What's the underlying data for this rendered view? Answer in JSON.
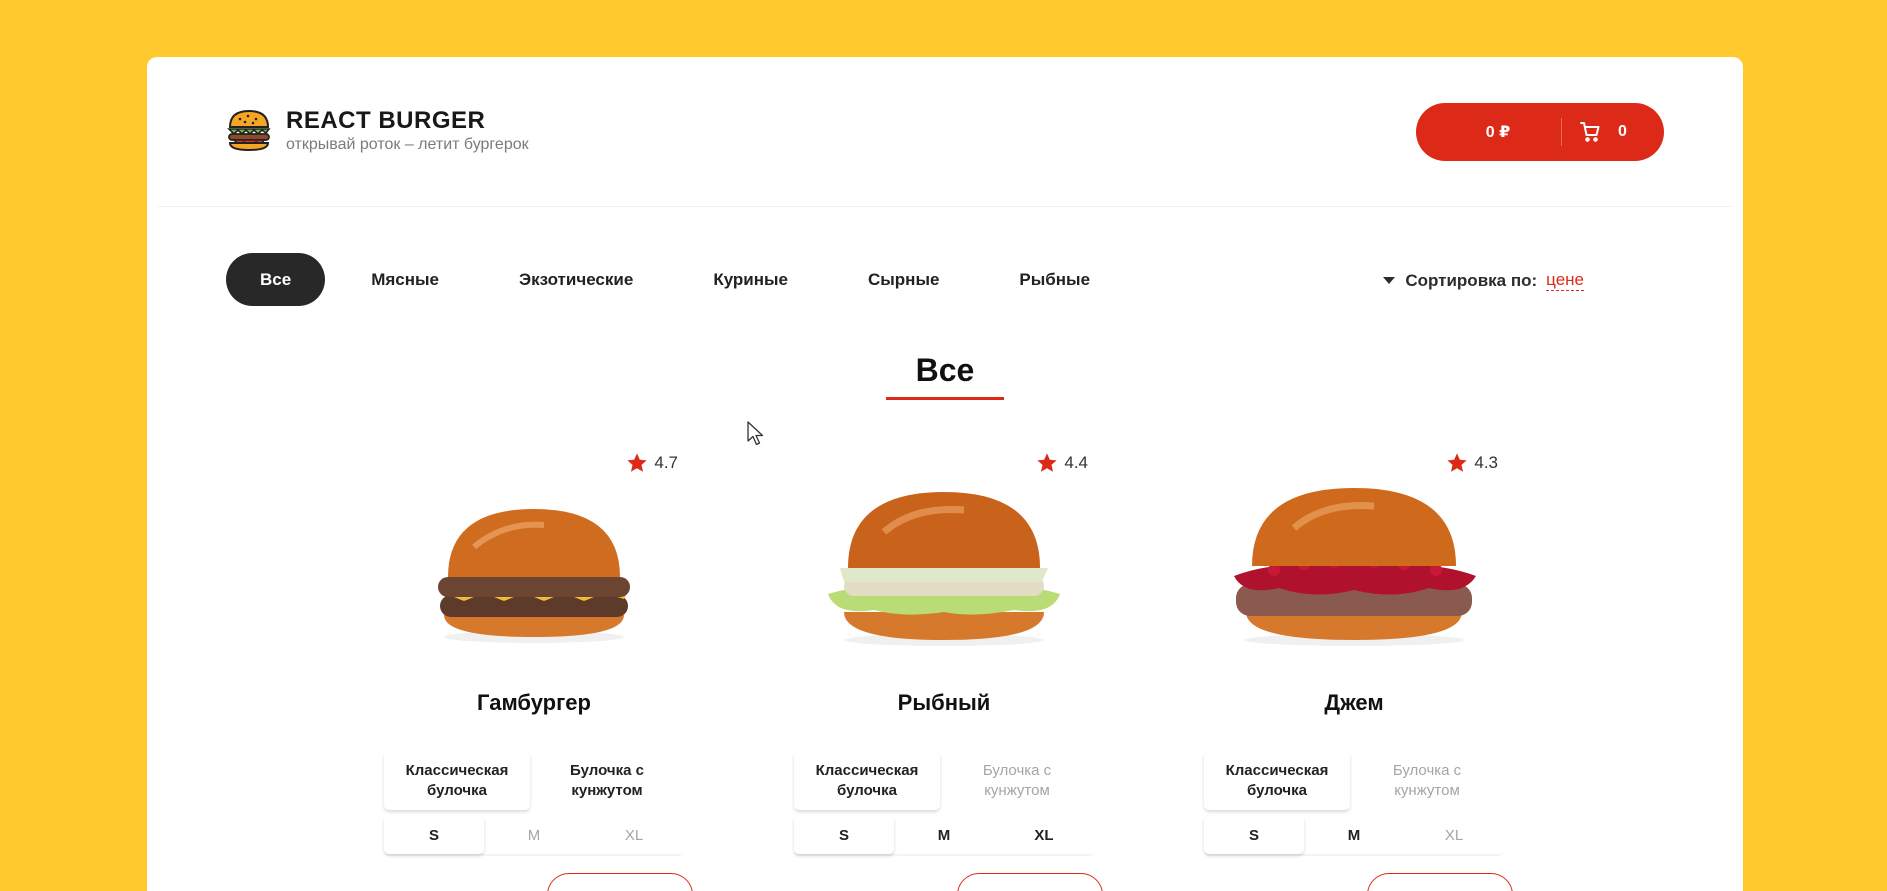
{
  "header": {
    "title": "REACT BURGER",
    "subtitle": "открывай роток – летит бургерок",
    "cart_price": "0 ₽",
    "cart_count": "0"
  },
  "categories": [
    {
      "label": "Все",
      "active": true
    },
    {
      "label": "Мясные",
      "active": false
    },
    {
      "label": "Экзотические",
      "active": false
    },
    {
      "label": "Куриные",
      "active": false
    },
    {
      "label": "Сырные",
      "active": false
    },
    {
      "label": "Рыбные",
      "active": false
    }
  ],
  "sort": {
    "label": "Сортировка по:",
    "value": "цене"
  },
  "section_title": "Все",
  "products": [
    {
      "title": "Гамбургер",
      "rating": "4.7",
      "buns": [
        {
          "label": "Классическая булочка",
          "state": "active"
        },
        {
          "label": "Булочка с кунжутом",
          "state": "normal"
        }
      ],
      "sizes": [
        {
          "label": "S",
          "state": "active"
        },
        {
          "label": "M",
          "state": "disabled"
        },
        {
          "label": "XL",
          "state": "disabled"
        }
      ],
      "price": "",
      "add_label": ""
    },
    {
      "title": "Рыбный",
      "rating": "4.4",
      "buns": [
        {
          "label": "Классическая булочка",
          "state": "active"
        },
        {
          "label": "Булочка с кунжутом",
          "state": "disabled"
        }
      ],
      "sizes": [
        {
          "label": "S",
          "state": "active"
        },
        {
          "label": "M",
          "state": "normal"
        },
        {
          "label": "XL",
          "state": "normal"
        }
      ],
      "price": "",
      "add_label": ""
    },
    {
      "title": "Джем",
      "rating": "4.3",
      "buns": [
        {
          "label": "Классическая булочка",
          "state": "active"
        },
        {
          "label": "Булочка с кунжутом",
          "state": "disabled"
        }
      ],
      "sizes": [
        {
          "label": "S",
          "state": "active"
        },
        {
          "label": "M",
          "state": "normal"
        },
        {
          "label": "XL",
          "state": "disabled"
        }
      ],
      "price": "",
      "add_label": ""
    }
  ],
  "colors": {
    "background": "#ffc82c",
    "accent": "#dd2a18",
    "dark": "#282828"
  },
  "icons": [
    "burger-logo-icon",
    "cart-icon",
    "star-icon",
    "sort-arrow-icon",
    "mouse-cursor-icon"
  ]
}
